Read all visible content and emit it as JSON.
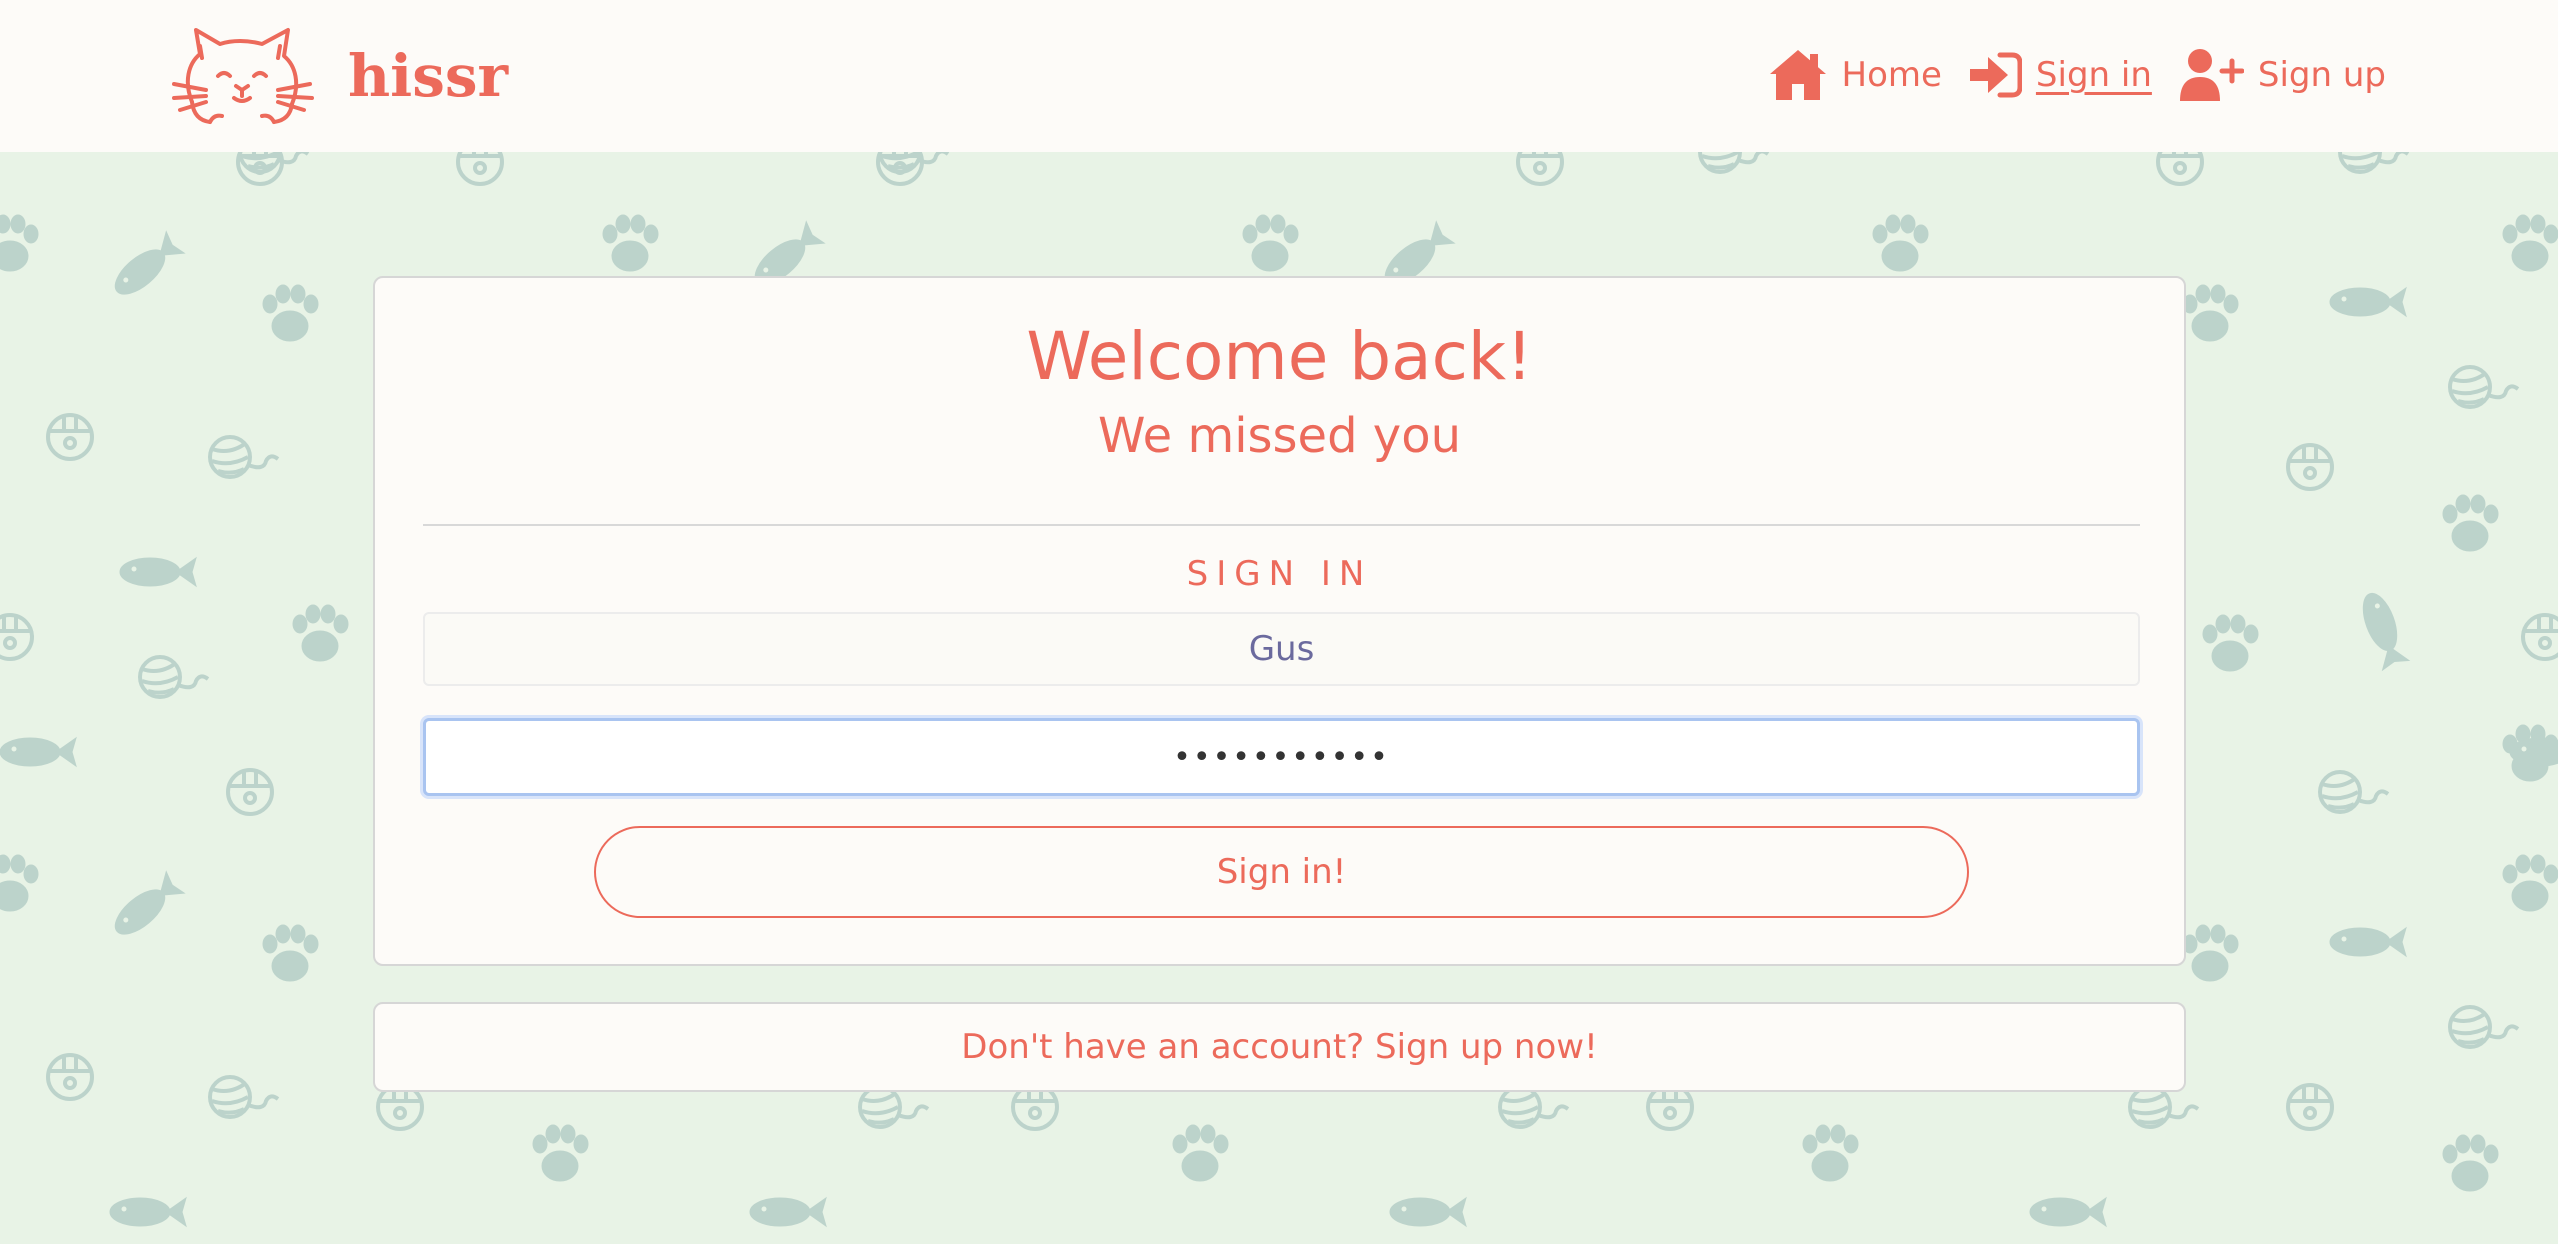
{
  "brand": {
    "name": "hissr"
  },
  "nav": {
    "items": [
      {
        "label": "Home",
        "icon": "home-icon",
        "active": false
      },
      {
        "label": "Sign in",
        "icon": "sign-in-icon",
        "active": true
      },
      {
        "label": "Sign up",
        "icon": "user-plus-icon",
        "active": false
      }
    ]
  },
  "card": {
    "title": "Welcome back!",
    "subtitle": "We missed you",
    "section_label": "SIGN IN",
    "username_value": "Gus",
    "password_value": "•••••••••••",
    "submit_label": "Sign in!"
  },
  "signup": {
    "text": "Don't have an account? Sign up now!"
  },
  "colors": {
    "accent": "#ec6a5b",
    "background": "#e8f3e6",
    "pattern": "#bcd3cb",
    "surface": "#fdfbf8",
    "focus_ring": "#a9c4f0"
  },
  "background_pattern": {
    "icons": [
      "paw-icon",
      "fish-icon",
      "yarn-ball-icon",
      "cat-bell-icon"
    ]
  }
}
